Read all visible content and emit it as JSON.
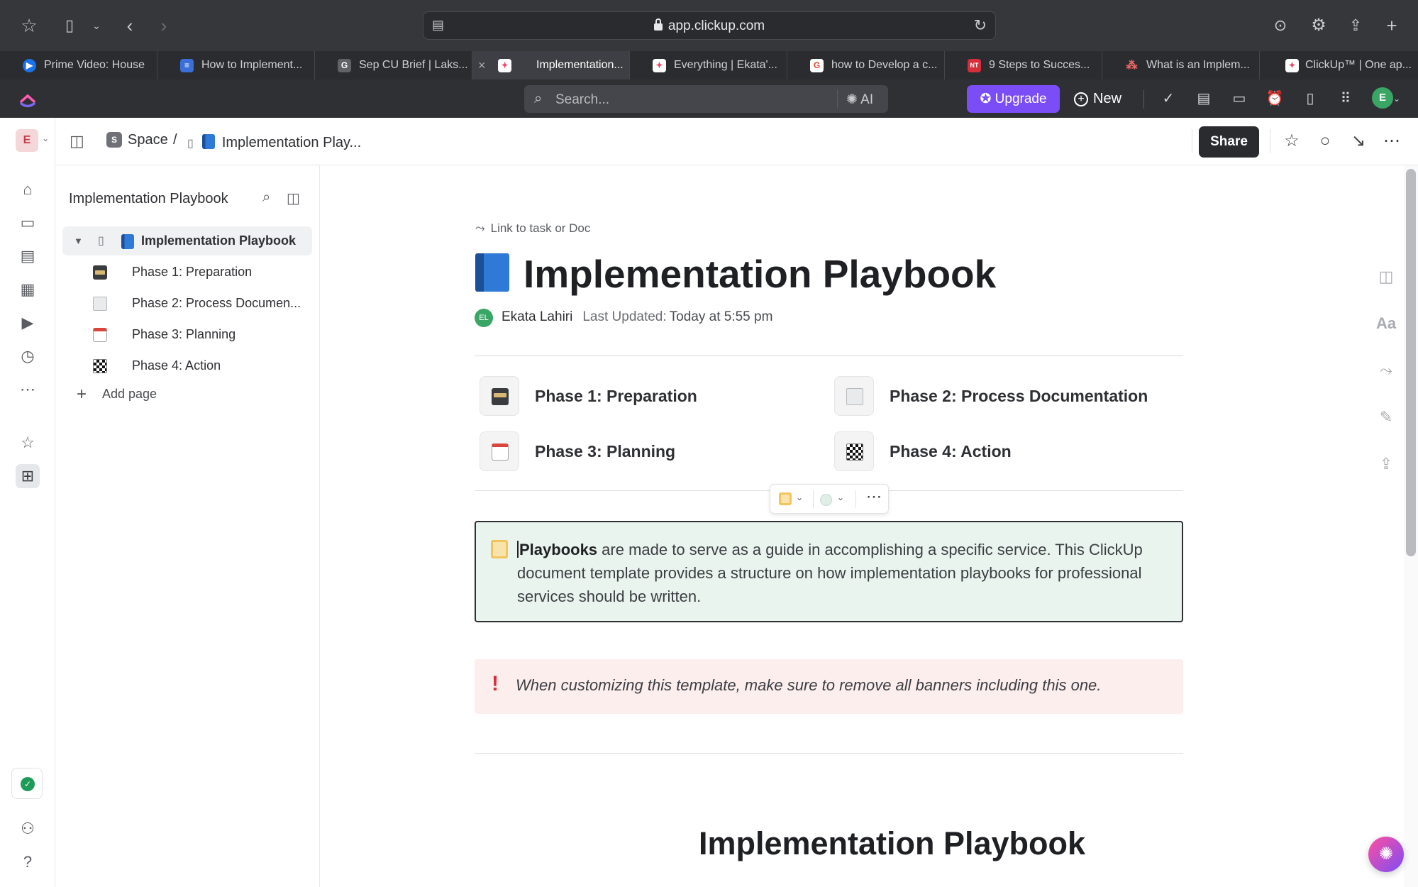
{
  "browser": {
    "url": "app.clickup.com",
    "tabs": [
      {
        "title": "Prime Video: House",
        "favicon": "prime-video",
        "color": "#1a73e8"
      },
      {
        "title": "How to Implement...",
        "favicon": "docs",
        "color": "#3b6fd8"
      },
      {
        "title": "Sep CU Brief | Laks...",
        "favicon": "G",
        "color": "#5f6368"
      },
      {
        "title": "Implementation...",
        "favicon": "clickup",
        "color": "#e84b6a",
        "active": true
      },
      {
        "title": "Everything | Ekata'...",
        "favicon": "clickup",
        "color": "#e84b6a"
      },
      {
        "title": "how to Develop a c...",
        "favicon": "google",
        "color": "#ea4335"
      },
      {
        "title": "9 Steps to Succes...",
        "favicon": "NT",
        "color": "#d62f3c"
      },
      {
        "title": "What is an Implem...",
        "favicon": "asana",
        "color": "#f06a6a"
      },
      {
        "title": "ClickUp™ | One ap...",
        "favicon": "clickup",
        "color": "#e84b6a"
      }
    ]
  },
  "topbar": {
    "search_placeholder": "Search...",
    "ai_label": "AI",
    "upgrade_label": "Upgrade",
    "new_label": "New",
    "avatar_initial": "E"
  },
  "rail": {
    "workspace_initial": "E"
  },
  "breadcrumb": {
    "space_badge": "S",
    "space": "Space",
    "separator": "/",
    "doc": "Implementation Play..."
  },
  "header": {
    "share_label": "Share"
  },
  "sidebar": {
    "title": "Implementation Playbook",
    "root_page": "Implementation Playbook",
    "pages": [
      {
        "label": "Phase 1: Preparation",
        "icon": "card-file-box-icon"
      },
      {
        "label": "Phase 2: Process Documen...",
        "icon": "page-icon"
      },
      {
        "label": "Phase 3: Planning",
        "icon": "calendar-icon"
      },
      {
        "label": "Phase 4: Action",
        "icon": "checkered-flag-icon"
      }
    ],
    "add_page_label": "Add page"
  },
  "doc": {
    "link_label": "Link to task or Doc",
    "title": "Implementation Playbook",
    "author_initials": "EL",
    "author": "Ekata Lahiri",
    "last_updated_label": "Last Updated:",
    "last_updated_value": "Today at 5:55 pm",
    "subpages": [
      {
        "label": "Phase 1: Preparation"
      },
      {
        "label": "Phase 2: Process Documentation"
      },
      {
        "label": "Phase 3: Planning"
      },
      {
        "label": "Phase 4: Action"
      }
    ],
    "callout_bold": "Playbooks",
    "callout_text": " are made to serve as a guide in accomplishing a specific service. This ClickUp document template provides a structure on how implementation playbooks for professional services should be written.",
    "banner_text": "When customizing this template, make sure to remove all banners including this one.",
    "section_heading": "Implementation Playbook",
    "tools": [
      "panel-icon",
      "Aa",
      "link-icon",
      "magic-wand-icon",
      "export-icon"
    ]
  },
  "colors": {
    "accent": "#7b4df6",
    "chrome": "#36373b",
    "callout_bg": "#eaf4ee",
    "banner_bg": "#fdeeee",
    "banner_icon": "#d62f3c"
  }
}
